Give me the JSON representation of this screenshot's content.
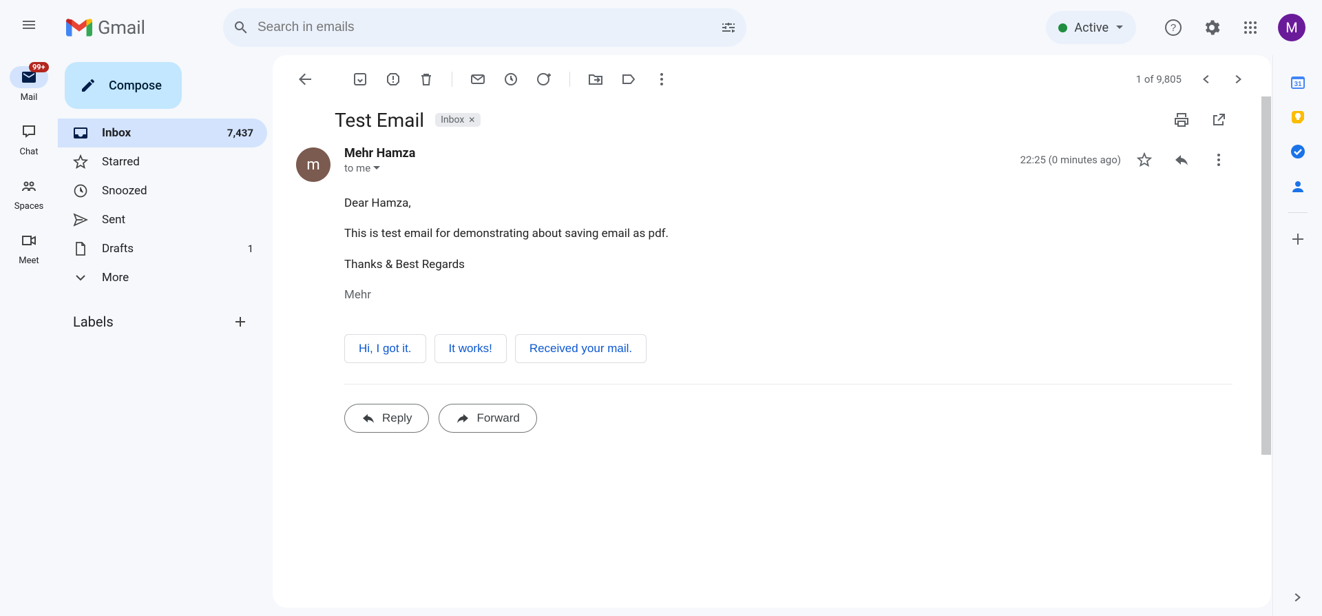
{
  "brand": {
    "name": "Gmail"
  },
  "search": {
    "placeholder": "Search in emails"
  },
  "status": {
    "label": "Active"
  },
  "avatar": {
    "initial": "M"
  },
  "left_rail": {
    "badge": "99+",
    "items": [
      {
        "label": "Mail"
      },
      {
        "label": "Chat"
      },
      {
        "label": "Spaces"
      },
      {
        "label": "Meet"
      }
    ]
  },
  "compose": {
    "label": "Compose"
  },
  "folders": [
    {
      "label": "Inbox",
      "count": "7,437",
      "selected": true
    },
    {
      "label": "Starred"
    },
    {
      "label": "Snoozed"
    },
    {
      "label": "Sent"
    },
    {
      "label": "Drafts",
      "count": "1"
    },
    {
      "label": "More"
    }
  ],
  "labels_header": "Labels",
  "pagination": {
    "text": "1 of 9,805"
  },
  "message": {
    "subject": "Test Email",
    "category_chip": "Inbox",
    "sender_name": "Mehr Hamza",
    "sender_initial": "m",
    "recipients_text": "to me",
    "timestamp": "22:25 (0 minutes ago)",
    "body": {
      "greeting": "Dear Hamza,",
      "line1": "This is test email for demonstrating about saving email as pdf.",
      "closing": "Thanks & Best Regards",
      "signature": "Mehr"
    }
  },
  "smart_replies": [
    "Hi, I got it.",
    "It works!",
    "Received your mail."
  ],
  "actions": {
    "reply": "Reply",
    "forward": "Forward"
  }
}
